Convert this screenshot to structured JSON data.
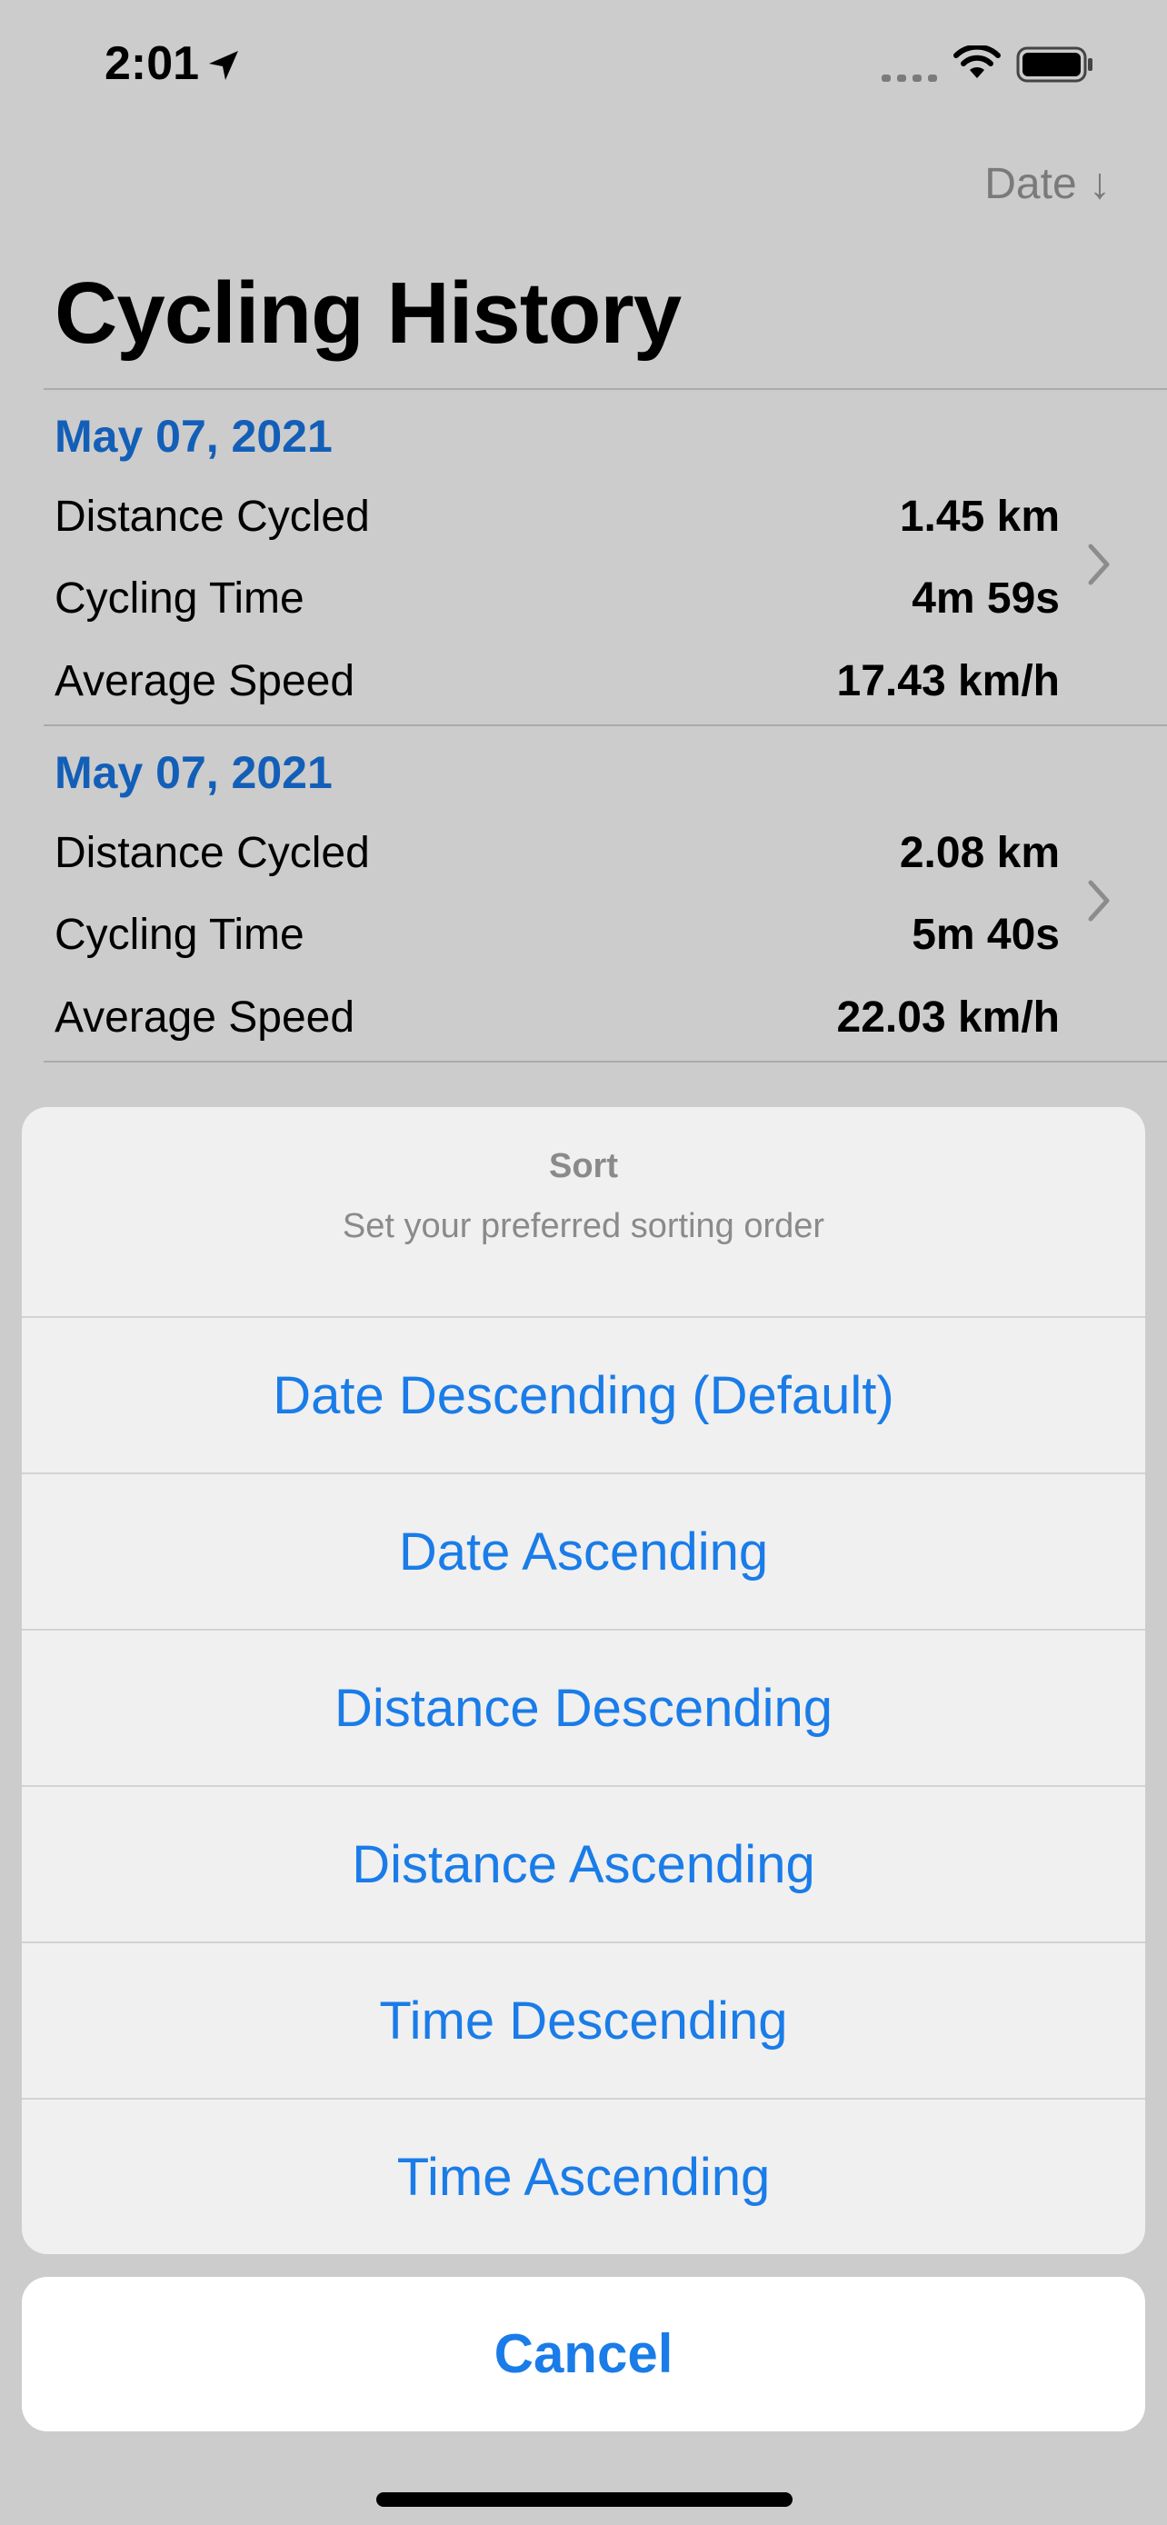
{
  "status_bar": {
    "time": "2:01",
    "icons": [
      "location-arrow-icon",
      "cellular-signal-icon",
      "wifi-icon",
      "battery-icon"
    ]
  },
  "nav": {
    "sort_label": "Date ↓"
  },
  "page_title": "Cycling History",
  "entries": [
    {
      "date": "May 07, 2021",
      "rows": [
        {
          "label": "Distance Cycled",
          "value": "1.45 km"
        },
        {
          "label": "Cycling Time",
          "value": "4m 59s"
        },
        {
          "label": "Average Speed",
          "value": "17.43 km/h"
        }
      ]
    },
    {
      "date": "May 07, 2021",
      "rows": [
        {
          "label": "Distance Cycled",
          "value": "2.08 km"
        },
        {
          "label": "Cycling Time",
          "value": "5m 40s"
        },
        {
          "label": "Average Speed",
          "value": "22.03 km/h"
        }
      ]
    }
  ],
  "action_sheet": {
    "title": "Sort",
    "message": "Set your preferred sorting order",
    "options": [
      "Date Descending (Default)",
      "Date Ascending",
      "Distance Descending",
      "Distance Ascending",
      "Time Descending",
      "Time Ascending"
    ],
    "cancel_label": "Cancel"
  },
  "colors": {
    "accent": "#1a7ce8",
    "date_header": "#1877e6",
    "muted": "#8a8a8a"
  }
}
